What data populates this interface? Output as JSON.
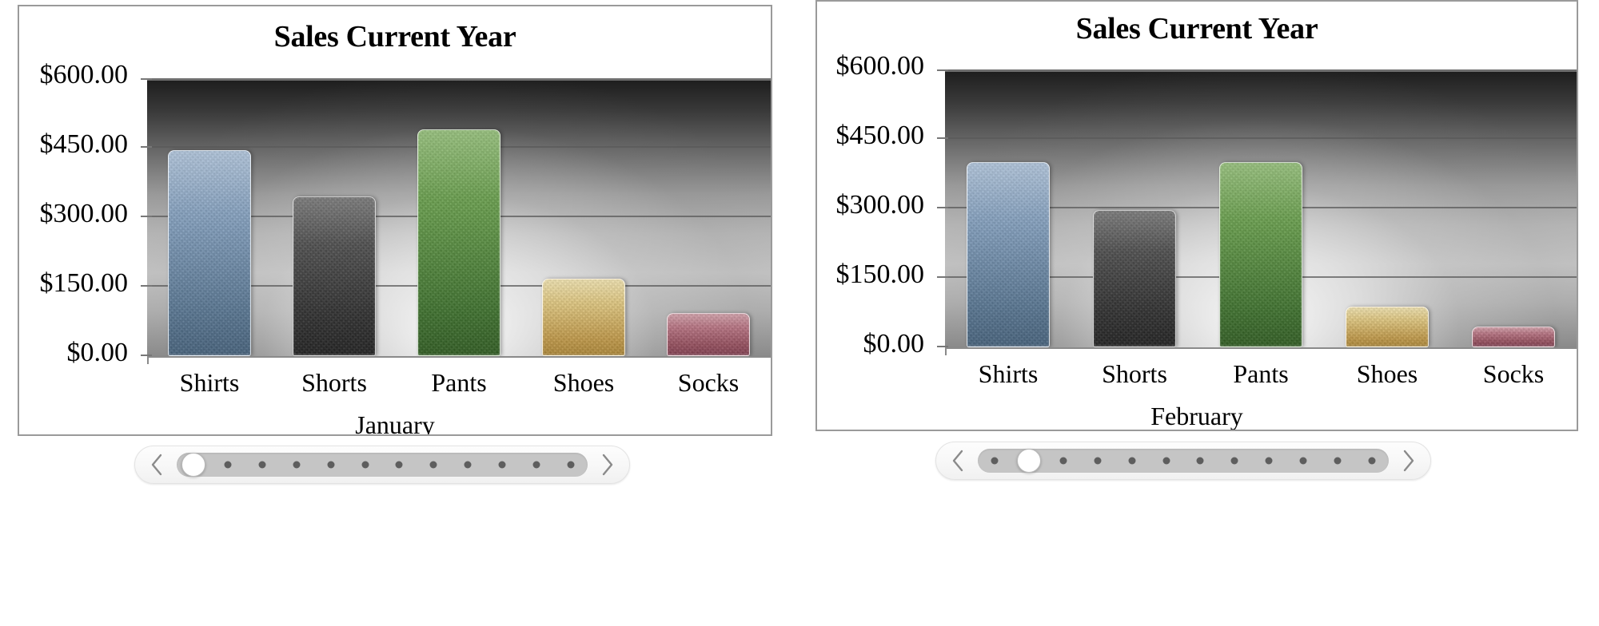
{
  "charts": [
    {
      "id": "january",
      "title": "Sales Current Year",
      "axis_title": "January",
      "y_ticks": [
        "$600.00",
        "$450.00",
        "$300.00",
        "$150.00",
        "$0.00"
      ],
      "categories": [
        "Shirts",
        "Shorts",
        "Pants",
        "Shoes",
        "Socks"
      ],
      "slider": {
        "prev_label": "previous-month",
        "next_label": "next-month",
        "positions": 12,
        "selected_index": 0
      }
    },
    {
      "id": "february",
      "title": "Sales Current Year",
      "axis_title": "February",
      "y_ticks": [
        "$600.00",
        "$450.00",
        "$300.00",
        "$150.00",
        "$0.00"
      ],
      "categories": [
        "Shirts",
        "Shorts",
        "Pants",
        "Shoes",
        "Socks"
      ],
      "slider": {
        "prev_label": "previous-month",
        "next_label": "next-month",
        "positions": 12,
        "selected_index": 1
      }
    }
  ],
  "chart_data": [
    {
      "type": "bar",
      "title": "Sales Current Year",
      "xlabel": "January",
      "ylabel": "",
      "categories": [
        "Shirts",
        "Shorts",
        "Pants",
        "Shoes",
        "Socks"
      ],
      "values": [
        445,
        345,
        490,
        168,
        93
      ],
      "tick_values": [
        600,
        450,
        300,
        150,
        0
      ],
      "tick_labels": [
        "$600.00",
        "$450.00",
        "$300.00",
        "$150.00",
        "$0.00"
      ],
      "ylim": [
        0,
        600
      ],
      "grid": true,
      "legend": "none",
      "bar_colors": [
        "#7d9cbd",
        "#454545",
        "#5f9a42",
        "#e3c779",
        "#b96f7f"
      ]
    },
    {
      "type": "bar",
      "title": "Sales Current Year",
      "xlabel": "February",
      "ylabel": "",
      "categories": [
        "Shirts",
        "Shorts",
        "Pants",
        "Shoes",
        "Socks"
      ],
      "values": [
        400,
        297,
        400,
        88,
        45
      ],
      "tick_values": [
        600,
        450,
        300,
        150,
        0
      ],
      "tick_labels": [
        "$600.00",
        "$450.00",
        "$300.00",
        "$150.00",
        "$0.00"
      ],
      "ylim": [
        0,
        600
      ],
      "grid": true,
      "legend": "none",
      "bar_colors": [
        "#7d9cbd",
        "#454545",
        "#5f9a42",
        "#e3c779",
        "#b96f7f"
      ]
    }
  ]
}
